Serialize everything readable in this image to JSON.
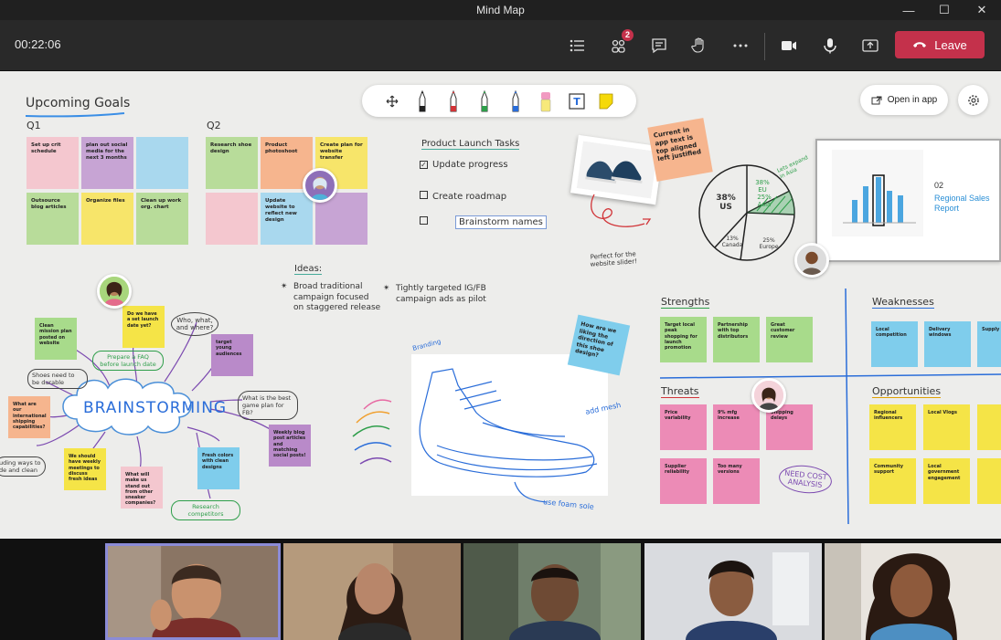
{
  "window": {
    "title": "Mind Map"
  },
  "call": {
    "timer": "00:22:06",
    "participants_badge": "2",
    "leave_label": "Leave"
  },
  "board": {
    "open_in_app_label": "Open in app",
    "upcoming_goals": "Upcoming Goals",
    "q1": "Q1",
    "q2": "Q2",
    "q1_notes": [
      "Set up crit schedule",
      "plan out social media for the next 3 months",
      "",
      "",
      "Outsource blog articles",
      "Organize files",
      "Clean up work org. chart"
    ],
    "q2_notes": [
      "Research shoe design",
      "Product photoshoot",
      "Create plan for website transfer",
      "",
      "Update website to reflect new design",
      ""
    ],
    "tasks": {
      "title": "Product Launch Tasks",
      "items": [
        "Update progress",
        "Create roadmap",
        "Brainstorm names"
      ]
    },
    "ideas": {
      "title": "Ideas:",
      "items": [
        "Broad traditional campaign focused on staggered release",
        "Tightly targeted IG/FB campaign ads as pilot"
      ]
    },
    "brainstorm": {
      "center": "BRAINSTORMING",
      "labels": [
        "Who, what, and where?",
        "Prepare a FAQ before launch date",
        "Shoes need to be durable",
        "What is the best game plan for FB?",
        "Research competitors",
        "uding ways to de and clean"
      ],
      "notes": [
        "Clean mission plan posted on website",
        "Do we have a set launch date yet?",
        "target young audiences",
        "What are our international shipping capabilities?",
        "We should have weekly meetings to discuss fresh ideas",
        "What will make us stand out from other sneaker companies?",
        "Fresh colors with clean designs",
        "Weekly blog post articles and matching social posts!"
      ]
    },
    "current_note": "Current in app text is top aligned left justified",
    "website_slider": "Perfect for the website slider!",
    "sketch_notes": [
      "Branding",
      "add mesh",
      "use foam sole"
    ],
    "blue_note": "How are we liking the direction of this shoe design?",
    "pie": {
      "labels": [
        "38% US",
        "38% EU",
        "25% Asia",
        "13% Canada",
        "25% Europe"
      ],
      "annotation": "Lets expand in Asia"
    },
    "slide": {
      "number": "02",
      "title": "Regional Sales Report"
    },
    "swot": {
      "strengths": "Strengths",
      "weaknesses": "Weaknesses",
      "threats": "Threats",
      "opportunities": "Opportunities",
      "strength_notes": [
        "Target local peak shopping for launch promotion",
        "Partnership with top distributors",
        "Great customer review"
      ],
      "weakness_notes": [
        "Local competition",
        "Delivery windows",
        "Supply uncert"
      ],
      "threat_notes": [
        "Price variability",
        "9% mfg increase",
        "Shipping delays",
        "Supplier reliability",
        "Too many versions"
      ],
      "opportunity_notes": [
        "Regional influencers",
        "Local Vlogs",
        "",
        "Community support",
        "Local government engagement",
        ""
      ],
      "need_analysis": "NEED COST ANALYSIS"
    }
  },
  "colors": {
    "leave": "#c4314b",
    "canvas": "#ededeb",
    "bar": "#292929"
  }
}
